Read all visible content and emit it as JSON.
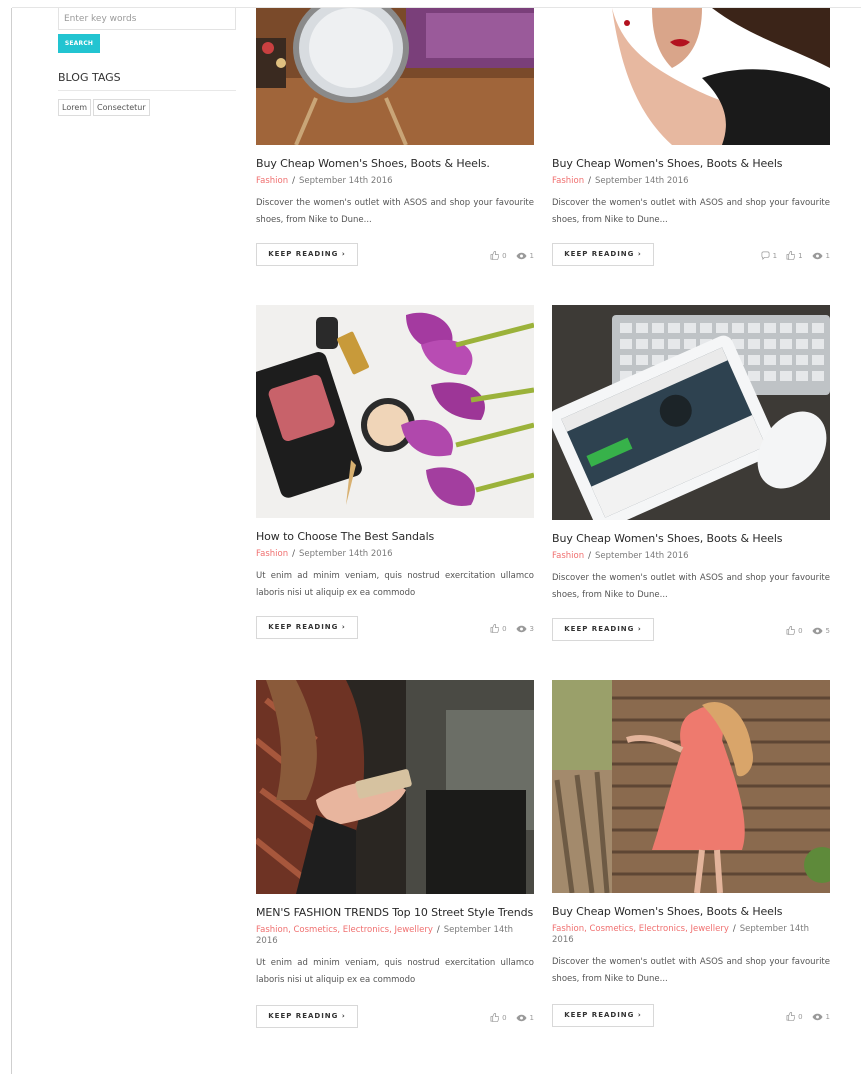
{
  "sidebar": {
    "search_placeholder": "Enter key words",
    "search_button": "SEARCH",
    "tags_title": "BLOG TAGS",
    "tags": [
      "Lorem",
      "Consectetur"
    ]
  },
  "posts": [
    {
      "title": "Buy Cheap Women's Shoes, Boots & Heels.",
      "categories": "Fashion",
      "date": "September 14th 2016",
      "excerpt": "Discover the women's outlet with ASOS and shop your favourite shoes, from Nike to Dune...",
      "button": "KEEP READING  ›",
      "likes": "0",
      "views": "1"
    },
    {
      "title": "Buy Cheap Women's Shoes, Boots & Heels",
      "categories": "Fashion",
      "date": "September 14th 2016",
      "excerpt": "Discover the women's outlet with ASOS and shop your favourite shoes, from Nike to Dune...",
      "button": "KEEP READING  ›",
      "comments": "1",
      "likes": "1",
      "views": "1"
    },
    {
      "title": "How to Choose The Best Sandals",
      "categories": "Fashion",
      "date": "September 14th 2016",
      "excerpt": "Ut enim ad minim veniam, quis nostrud exercitation ullamco laboris nisi ut aliquip ex ea commodo",
      "button": "KEEP READING  ›",
      "likes": "0",
      "views": "3"
    },
    {
      "title": "Buy Cheap Women's Shoes, Boots & Heels",
      "categories": "Fashion",
      "date": "September 14th 2016",
      "excerpt": "Discover the women's outlet with ASOS and shop your favourite shoes, from Nike to Dune...",
      "button": "KEEP READING  ›",
      "likes": "0",
      "views": "5"
    },
    {
      "title": "MEN'S FASHION TRENDS Top 10 Street Style Trends",
      "categories": "Fashion, Cosmetics, Electronics, Jewellery",
      "date": "September 14th 2016",
      "excerpt": "Ut enim ad minim veniam, quis nostrud exercitation ullamco laboris nisi ut aliquip ex ea commodo",
      "button": "KEEP READING  ›",
      "likes": "0",
      "views": "1"
    },
    {
      "title": "Buy Cheap Women's Shoes, Boots & Heels",
      "categories": "Fashion, Cosmetics, Electronics, Jewellery",
      "date": "September 14th 2016",
      "excerpt": "Discover the women's outlet with ASOS and shop your favourite shoes, from Nike to Dune...",
      "button": "KEEP READING  ›",
      "likes": "0",
      "views": "1"
    }
  ],
  "colors": {
    "accent": "#22c4d1",
    "category": "#f07070"
  }
}
